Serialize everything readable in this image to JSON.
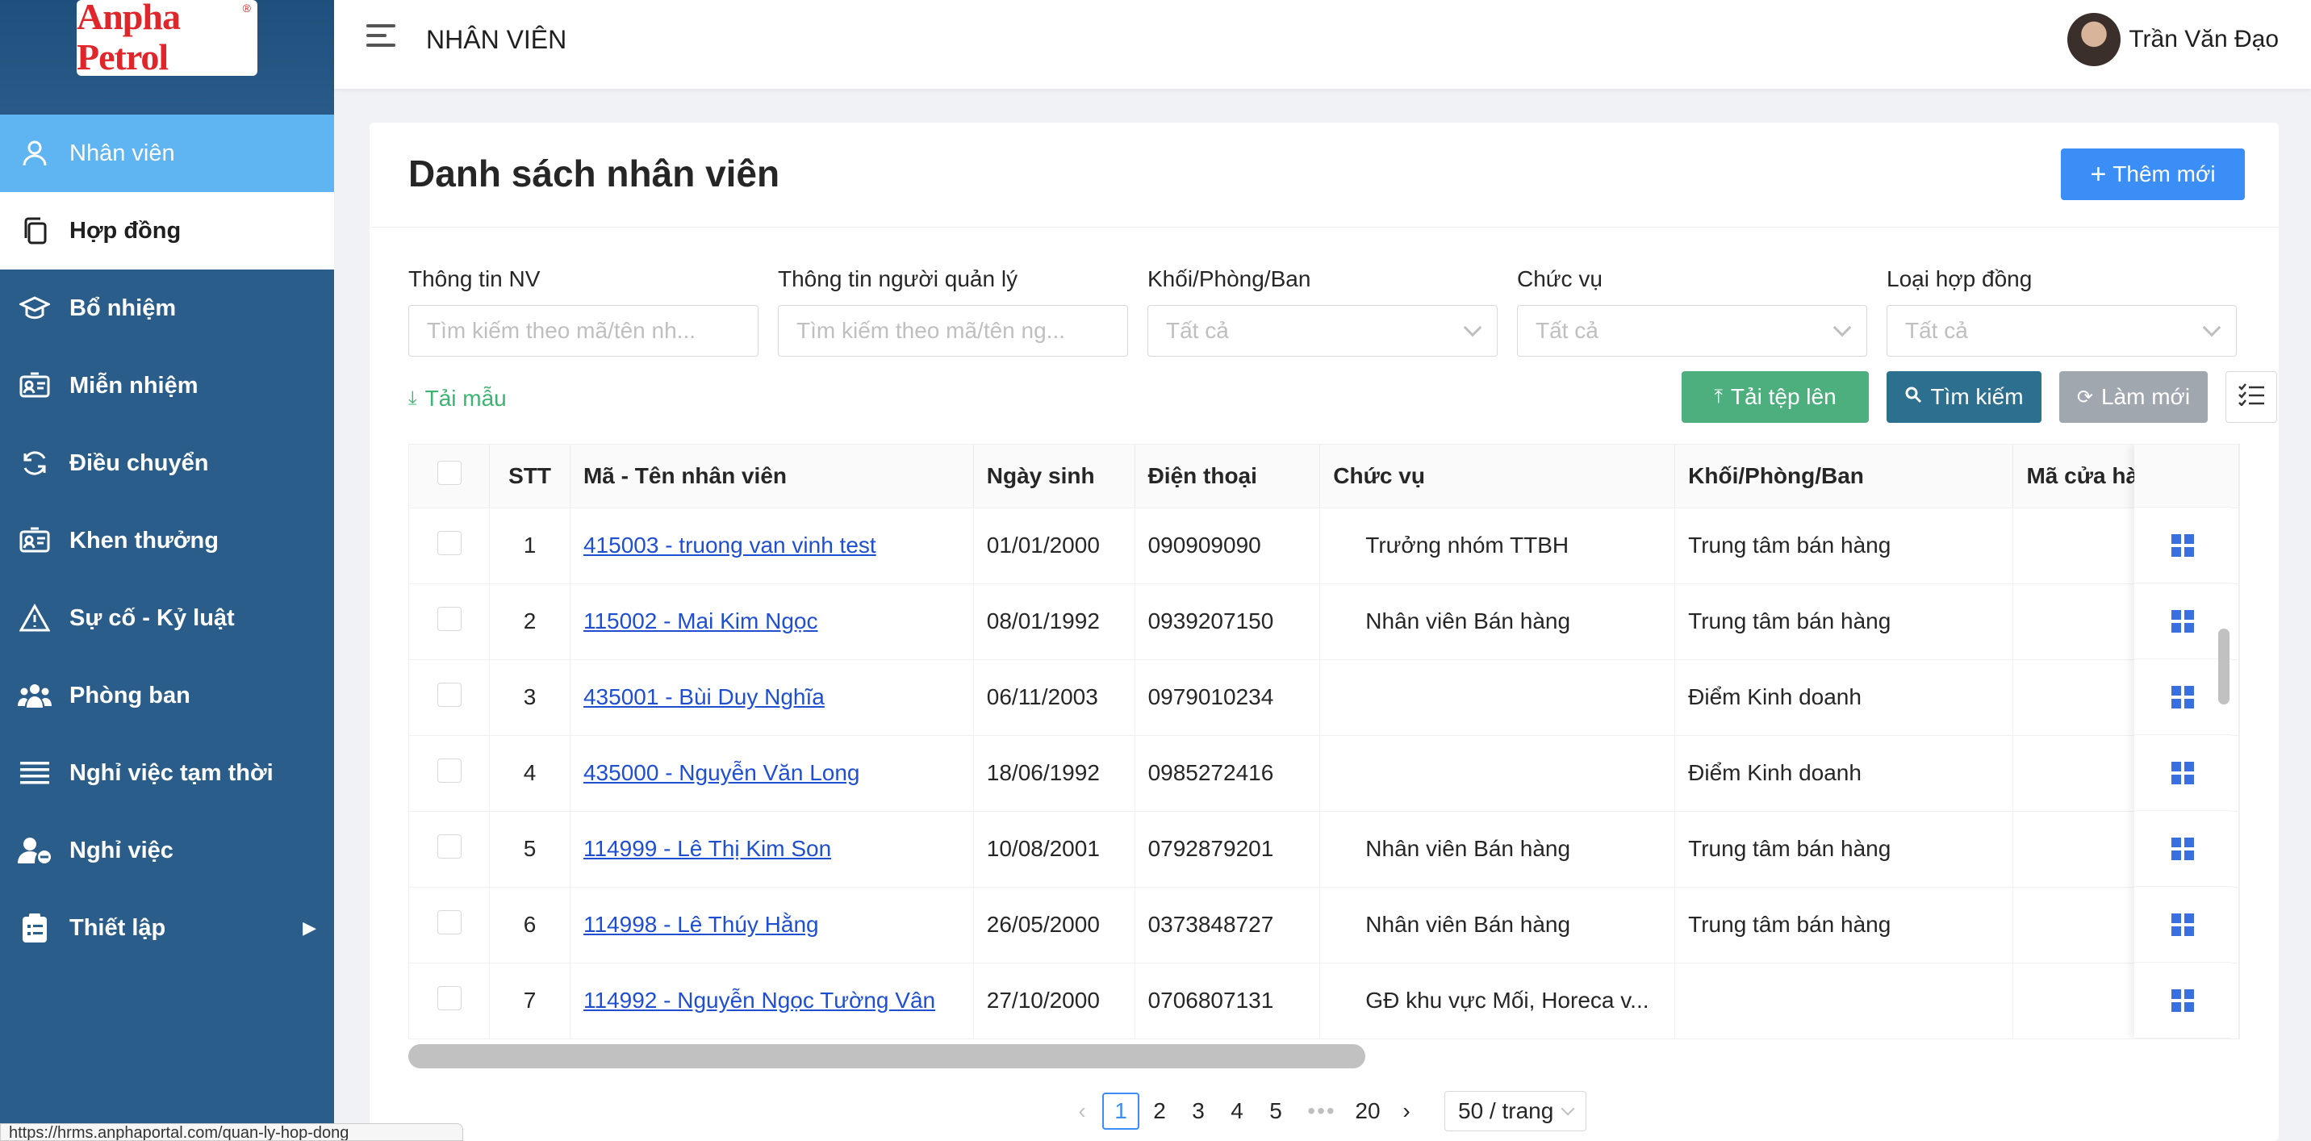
{
  "brand": {
    "logo_text": "Anpha Petrol",
    "reg_mark": "®"
  },
  "sidebar": {
    "items": [
      {
        "label": "Nhân viên",
        "icon": "user-icon"
      },
      {
        "label": "Hợp đồng",
        "icon": "copy-icon"
      },
      {
        "label": "Bổ nhiệm",
        "icon": "graduation-cap-icon"
      },
      {
        "label": "Miễn nhiệm",
        "icon": "id-card-icon"
      },
      {
        "label": "Điều chuyển",
        "icon": "transfer-icon"
      },
      {
        "label": "Khen thưởng",
        "icon": "award-card-icon"
      },
      {
        "label": "Sự cố - Kỷ luật",
        "icon": "warning-icon"
      },
      {
        "label": "Phòng ban",
        "icon": "team-icon"
      },
      {
        "label": "Nghỉ việc tạm thời",
        "icon": "list-icon"
      },
      {
        "label": "Nghỉ việc",
        "icon": "user-minus-icon"
      },
      {
        "label": "Thiết lập",
        "icon": "clipboard-icon",
        "arrow": "▶"
      }
    ]
  },
  "header": {
    "title": "NHÂN VIÊN",
    "user_name": "Trần Văn Đạo"
  },
  "page": {
    "title": "Danh sách nhân viên",
    "add_button": "Thêm mới",
    "filters": [
      {
        "label": "Thông tin NV",
        "placeholder": "Tìm kiếm theo mã/tên nh..."
      },
      {
        "label": "Thông tin người quản lý",
        "placeholder": "Tìm kiếm theo mã/tên ng..."
      },
      {
        "label": "Khối/Phòng/Ban",
        "placeholder": "Tất cả"
      },
      {
        "label": "Chức vụ",
        "placeholder": "Tất cả"
      },
      {
        "label": "Loại hợp đồng",
        "placeholder": "Tất cả"
      }
    ],
    "download_template": "Tải mẫu",
    "upload_button": "Tải tệp lên",
    "search_button": "Tìm kiếm",
    "refresh_button": "Làm mới"
  },
  "table": {
    "columns": [
      "STT",
      "Mã - Tên nhân viên",
      "Ngày sinh",
      "Điện thoại",
      "Chức vụ",
      "Khối/Phòng/Ban",
      "Mã cửa hà"
    ],
    "rows": [
      {
        "stt": "1",
        "employee": "415003 - truong van vinh test",
        "dob": "01/01/2000",
        "phone": "090909090",
        "position": "Trưởng nhóm TTBH",
        "dept": "Trung tâm bán hàng"
      },
      {
        "stt": "2",
        "employee": "115002 - Mai Kim Ngọc",
        "dob": "08/01/1992",
        "phone": "0939207150",
        "position": "Nhân viên Bán hàng",
        "dept": "Trung tâm bán hàng"
      },
      {
        "stt": "3",
        "employee": "435001 - Bùi Duy Nghĩa",
        "dob": "06/11/2003",
        "phone": "0979010234",
        "position": "",
        "dept": "Điểm Kinh doanh"
      },
      {
        "stt": "4",
        "employee": "435000 - Nguyễn Văn Long",
        "dob": "18/06/1992",
        "phone": "0985272416",
        "position": "",
        "dept": "Điểm Kinh doanh"
      },
      {
        "stt": "5",
        "employee": "114999 - Lê Thị Kim Son",
        "dob": "10/08/2001",
        "phone": "0792879201",
        "position": "Nhân viên Bán hàng",
        "dept": "Trung tâm bán hàng"
      },
      {
        "stt": "6",
        "employee": "114998 - Lê Thúy Hằng",
        "dob": "26/05/2000",
        "phone": "0373848727",
        "position": "Nhân viên Bán hàng",
        "dept": "Trung tâm bán hàng"
      },
      {
        "stt": "7",
        "employee": "114992 - Nguyễn Ngọc Tường Vân",
        "dob": "27/10/2000",
        "phone": "0706807131",
        "position": "GĐ khu vực Mối, Horeca v...",
        "dept": ""
      }
    ]
  },
  "pagination": {
    "prev": "‹",
    "next": "›",
    "pages": [
      "1",
      "2",
      "3",
      "4",
      "5"
    ],
    "ellipsis": "•••",
    "last": "20",
    "current": "1",
    "page_size": "50 / trang"
  },
  "status_bar": {
    "url": "https://hrms.anphaportal.com/quan-ly-hop-dong"
  }
}
